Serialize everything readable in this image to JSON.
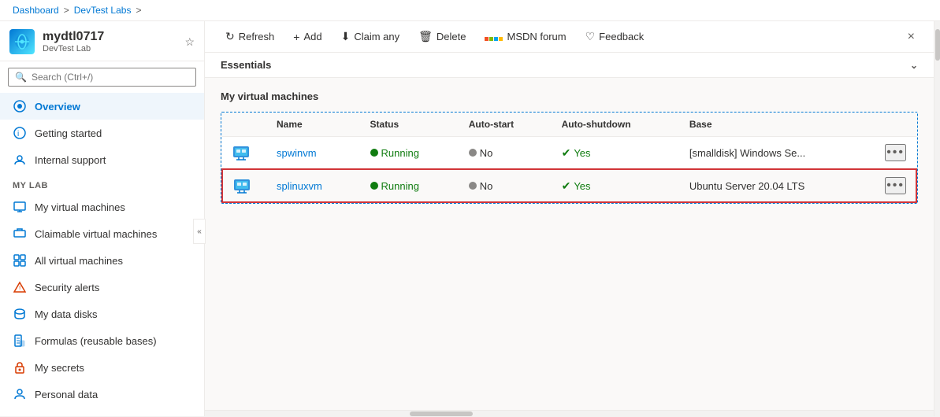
{
  "breadcrumb": {
    "items": [
      "Dashboard",
      "DevTest Labs"
    ],
    "separator": ">"
  },
  "sidebar": {
    "logo_text": "🔬",
    "title": "mydtl0717",
    "subtitle": "DevTest Lab",
    "search_placeholder": "Search (Ctrl+/)",
    "collapse_icon": "«",
    "nav_items": [
      {
        "id": "overview",
        "label": "Overview",
        "active": true
      },
      {
        "id": "getting-started",
        "label": "Getting started",
        "active": false
      },
      {
        "id": "internal-support",
        "label": "Internal support",
        "active": false
      }
    ],
    "my_lab_section": "My Lab",
    "my_lab_items": [
      {
        "id": "my-virtual-machines",
        "label": "My virtual machines",
        "active": false
      },
      {
        "id": "claimable-virtual-machines",
        "label": "Claimable virtual machines",
        "active": false
      },
      {
        "id": "all-virtual-machines",
        "label": "All virtual machines",
        "active": false
      },
      {
        "id": "security-alerts",
        "label": "Security alerts",
        "active": false
      },
      {
        "id": "my-data-disks",
        "label": "My data disks",
        "active": false
      },
      {
        "id": "formulas",
        "label": "Formulas (reusable bases)",
        "active": false
      },
      {
        "id": "my-secrets",
        "label": "My secrets",
        "active": false
      },
      {
        "id": "personal-data",
        "label": "Personal data",
        "active": false
      }
    ]
  },
  "toolbar": {
    "buttons": [
      {
        "id": "refresh",
        "icon": "↻",
        "label": "Refresh"
      },
      {
        "id": "add",
        "icon": "+",
        "label": "Add"
      },
      {
        "id": "claim-any",
        "icon": "⬇",
        "label": "Claim any"
      },
      {
        "id": "delete",
        "icon": "🗑",
        "label": "Delete"
      },
      {
        "id": "msdn-forum",
        "icon": "msdn",
        "label": "MSDN forum"
      },
      {
        "id": "feedback",
        "icon": "♡",
        "label": "Feedback"
      }
    ]
  },
  "essentials": {
    "label": "Essentials",
    "chevron": "⌄"
  },
  "vm_section": {
    "title": "My virtual machines",
    "columns": [
      "Name",
      "Status",
      "Auto-start",
      "Auto-shutdown",
      "Base"
    ],
    "rows": [
      {
        "id": "spwinvm",
        "name": "spwinvm",
        "status": "Running",
        "autostart": "No",
        "autoshutdown": "Yes",
        "base": "[smalldisk] Windows Se...",
        "highlighted": false
      },
      {
        "id": "splinuxvm",
        "name": "splinuxvm",
        "status": "Running",
        "autostart": "No",
        "autoshutdown": "Yes",
        "base": "Ubuntu Server 20.04 LTS",
        "highlighted": true
      }
    ]
  },
  "close_label": "×"
}
